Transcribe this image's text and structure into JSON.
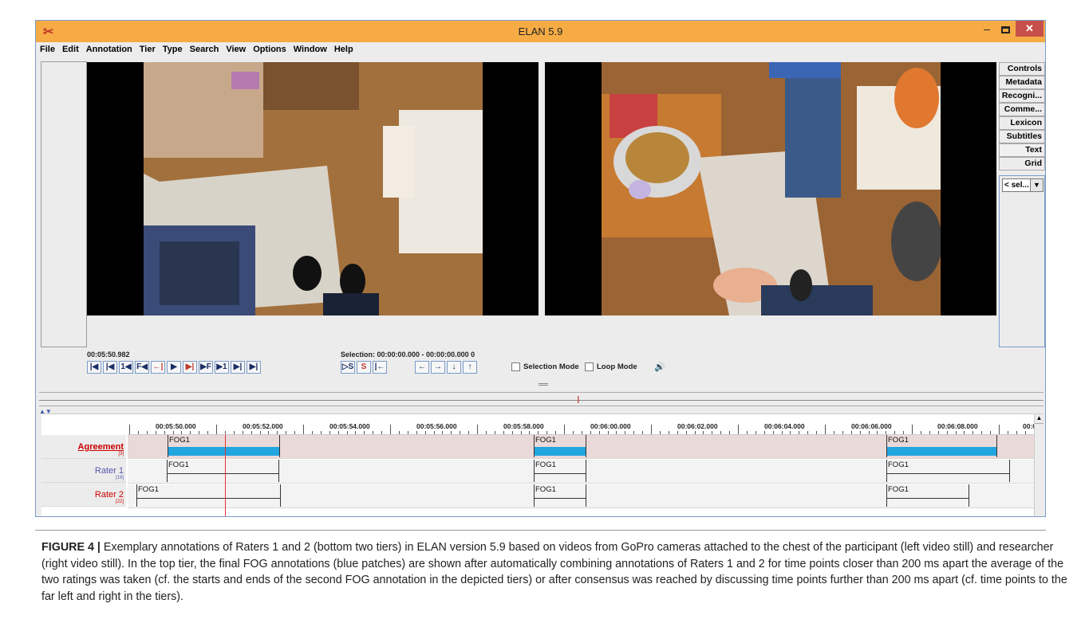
{
  "window": {
    "title": "ELAN 5.9",
    "logo": "elan-logo",
    "minimize": "–",
    "close": "✕"
  },
  "menu": [
    "File",
    "Edit",
    "Annotation",
    "Tier",
    "Type",
    "Search",
    "View",
    "Options",
    "Window",
    "Help"
  ],
  "side_tabs": [
    "Controls",
    "Metadata",
    "Recogni...",
    "Comme...",
    "Lexicon",
    "Subtitles",
    "Text",
    "Grid"
  ],
  "side_select": "< sel...",
  "media": {
    "current_time": "00:05:50.982",
    "selection": "Selection: 00:00:00.000 - 00:00:00.000  0",
    "selection_mode": "Selection Mode",
    "loop_mode": "Loop Mode",
    "playback_buttons": [
      "|◀",
      "|◀",
      "1◀",
      "F◀",
      "←|",
      "▶",
      "▶|",
      "▶F",
      "▶1",
      "▶|",
      "▶|"
    ],
    "selection_buttons": [
      "▷S",
      "S",
      "|←"
    ],
    "nav_buttons": [
      "←",
      "→",
      "↓",
      "↑"
    ]
  },
  "ruler": {
    "labels": [
      "00:05:50.000",
      "00:05:52.000",
      "00:05:54.000",
      "00:05:56.000",
      "00:05:58.000",
      "00:06:00.000",
      "00:06:02.000",
      "00:06:04.000",
      "00:06:06.000",
      "00:06:08.000",
      "00:0"
    ]
  },
  "tiers": [
    {
      "name": "Agreement",
      "count": "[3]",
      "annotations": [
        "FOG1",
        "FOG1",
        "FOG1"
      ]
    },
    {
      "name": "Rater 1",
      "count": "[19]",
      "annotations": [
        "FOG1",
        "FOG1",
        "FOG1"
      ]
    },
    {
      "name": "Rater 2",
      "count": "[22]",
      "annotations": [
        "FOG1",
        "FOG1",
        "FOG1"
      ]
    }
  ],
  "caption": {
    "label": "FIGURE 4 |",
    "text": " Exemplary annotations of Raters 1 and 2 (bottom two tiers) in ELAN version 5.9 based on videos from GoPro cameras attached to the chest of the participant (left video still) and researcher (right video still). In the top tier, the final FOG annotations (blue patches) are shown after automatically combining annotations of Raters 1 and 2 for time points closer than 200 ms apart the average of the two ratings was taken (cf. the starts and ends of the second FOG annotation in the depicted tiers) or after consensus was reached by discussing time points further than 200 ms apart (cf. time points to the far left and right in the tiers)."
  }
}
